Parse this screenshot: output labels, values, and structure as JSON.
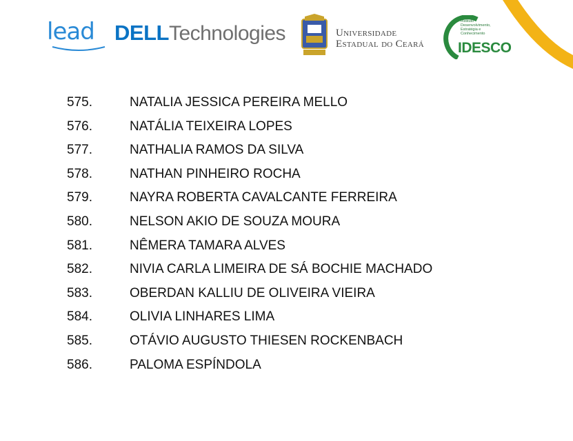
{
  "header": {
    "lead_logo": "lead",
    "dell_logo": "DELL",
    "dell_tech": "Technologies",
    "uece_line1": "Universidade",
    "uece_line2": "Estadual do Ceará",
    "idesco_small": "Instituto Desenvolvimento, Estratégia e Conhecimento",
    "idesco_logo": "IDESCO",
    "accent_colors": {
      "lead": "#2a8ad6",
      "dell": "#0a73c4",
      "idesco": "#2a8a3e",
      "corner": "#f3b316"
    }
  },
  "entries": [
    {
      "number": "575.",
      "name": "NATALIA JESSICA PEREIRA MELLO"
    },
    {
      "number": "576.",
      "name": "NATÁLIA TEIXEIRA LOPES"
    },
    {
      "number": "577.",
      "name": "NATHALIA RAMOS DA SILVA"
    },
    {
      "number": "578.",
      "name": "NATHAN PINHEIRO ROCHA"
    },
    {
      "number": "579.",
      "name": "NAYRA ROBERTA CAVALCANTE FERREIRA"
    },
    {
      "number": "580.",
      "name": "NELSON AKIO DE SOUZA MOURA"
    },
    {
      "number": "581.",
      "name": "NÊMERA TAMARA ALVES"
    },
    {
      "number": "582.",
      "name": "NIVIA CARLA LIMEIRA DE SÁ BOCHIE MACHADO"
    },
    {
      "number": "583.",
      "name": "OBERDAN KALLIU DE OLIVEIRA VIEIRA"
    },
    {
      "number": "584.",
      "name": "OLIVIA LINHARES LIMA"
    },
    {
      "number": "585.",
      "name": "OTÁVIO AUGUSTO THIESEN ROCKENBACH"
    },
    {
      "number": "586.",
      "name": "PALOMA ESPÍNDOLA"
    }
  ]
}
